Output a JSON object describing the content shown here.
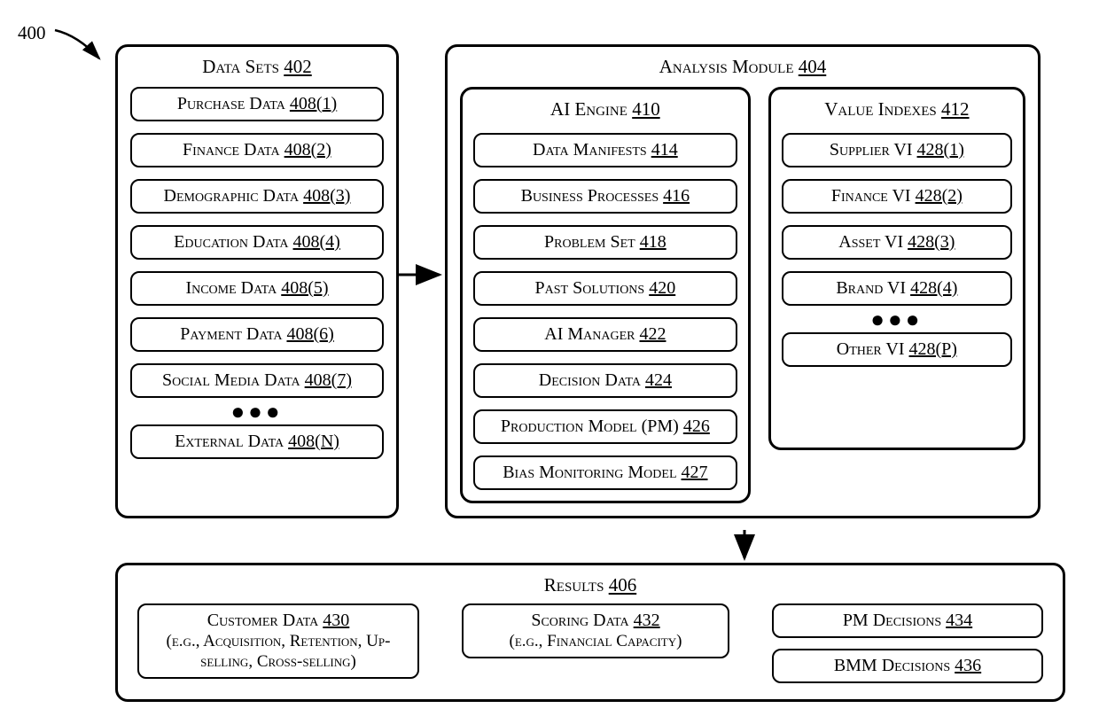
{
  "figure_label": "400",
  "data_sets": {
    "title": "Data Sets",
    "ref": "402",
    "items": [
      {
        "label": "Purchase Data",
        "ref": "408(1)"
      },
      {
        "label": "Finance Data",
        "ref": "408(2)"
      },
      {
        "label": "Demographic Data",
        "ref": "408(3)"
      },
      {
        "label": "Education Data",
        "ref": "408(4)"
      },
      {
        "label": "Income Data",
        "ref": "408(5)"
      },
      {
        "label": "Payment Data",
        "ref": "408(6)"
      },
      {
        "label": "Social Media Data",
        "ref": "408(7)"
      }
    ],
    "final": {
      "label": "External Data",
      "ref": "408(N)"
    }
  },
  "analysis_module": {
    "title": "Analysis Module",
    "ref": "404",
    "ai_engine": {
      "title": "AI Engine",
      "ref": "410",
      "items": [
        {
          "label": "Data Manifests",
          "ref": "414"
        },
        {
          "label": "Business Processes",
          "ref": "416"
        },
        {
          "label": "Problem Set",
          "ref": "418"
        },
        {
          "label": "Past Solutions",
          "ref": "420"
        },
        {
          "label": "AI Manager",
          "ref": "422"
        },
        {
          "label": "Decision Data",
          "ref": "424"
        },
        {
          "label": "Production Model (PM)",
          "ref": "426"
        },
        {
          "label": "Bias Monitoring Model",
          "ref": "427"
        }
      ]
    },
    "value_indexes": {
      "title": "Value Indexes",
      "ref": "412",
      "items": [
        {
          "label": "Supplier VI",
          "ref": "428(1)"
        },
        {
          "label": "Finance VI",
          "ref": "428(2)"
        },
        {
          "label": "Asset VI",
          "ref": "428(3)"
        },
        {
          "label": "Brand VI",
          "ref": "428(4)"
        }
      ],
      "final": {
        "label": "Other VI",
        "ref": "428(P)"
      }
    }
  },
  "results": {
    "title": "Results",
    "ref": "406",
    "customer": {
      "label": "Customer Data",
      "ref": "430",
      "sub": "(e.g., Acquisition, Retention, Up-selling, Cross-selling)"
    },
    "scoring": {
      "label": "Scoring Data",
      "ref": "432",
      "sub": "(e.g., Financial Capacity)"
    },
    "pm": {
      "label": "PM Decisions",
      "ref": "434"
    },
    "bmm": {
      "label": "BMM Decisions",
      "ref": "436"
    }
  }
}
